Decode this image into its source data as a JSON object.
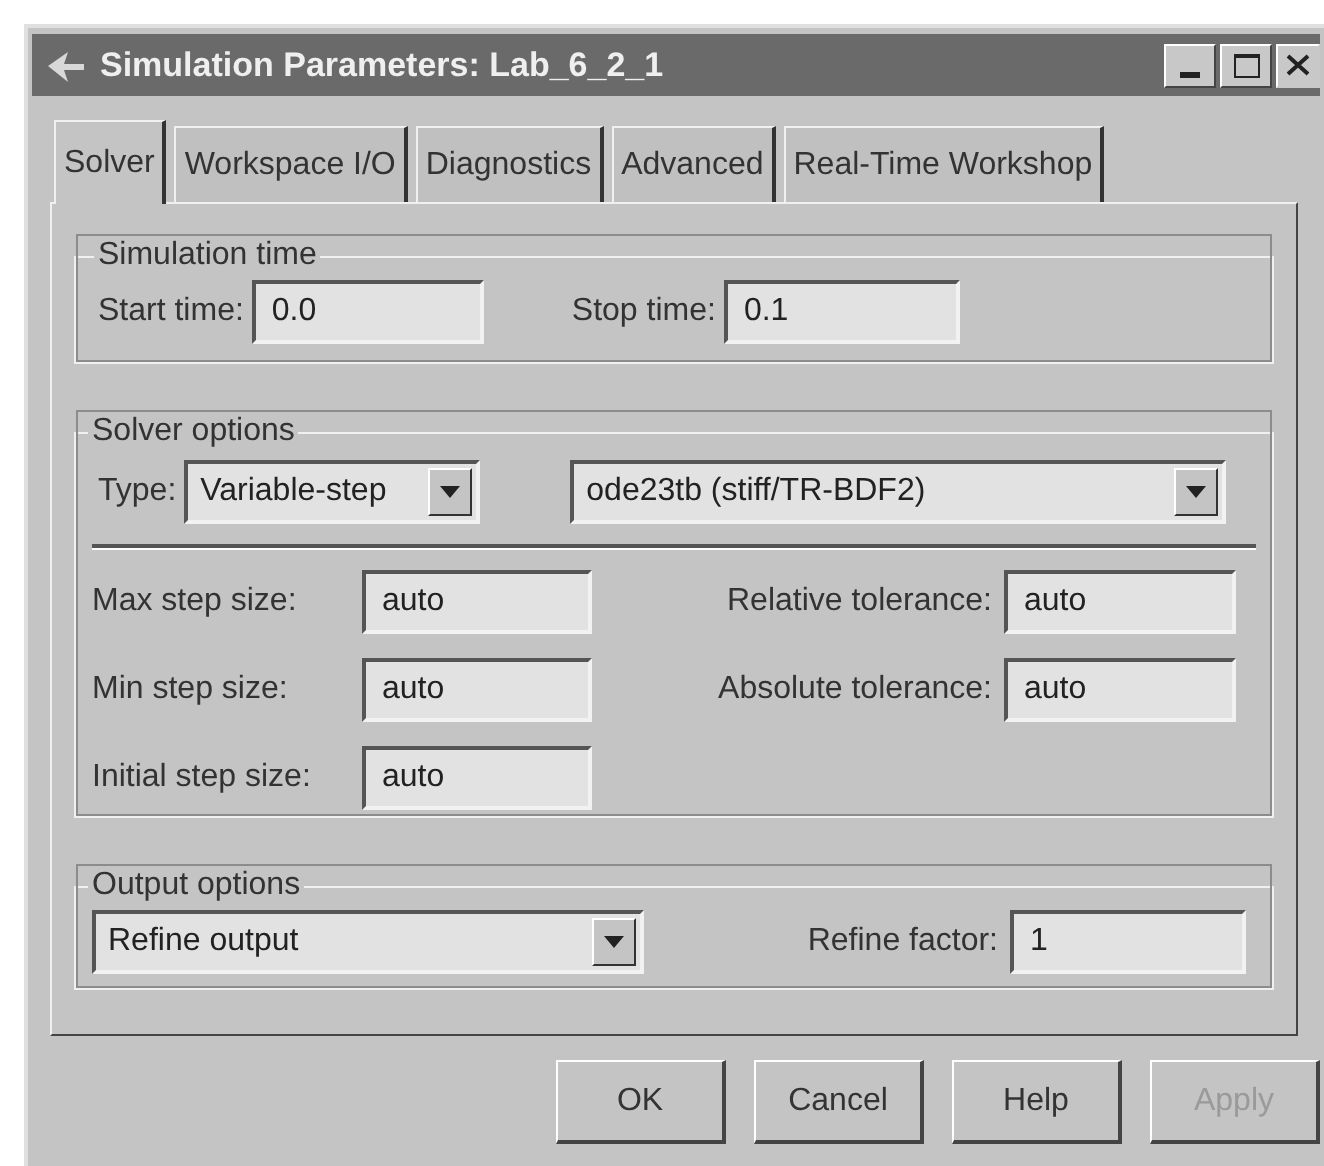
{
  "window": {
    "title": "Simulation Parameters: Lab_6_2_1"
  },
  "tabs": [
    {
      "label": "Solver",
      "selected": true
    },
    {
      "label": "Workspace I/O",
      "selected": false
    },
    {
      "label": "Diagnostics",
      "selected": false
    },
    {
      "label": "Advanced",
      "selected": false
    },
    {
      "label": "Real-Time Workshop",
      "selected": false
    }
  ],
  "simulation_time": {
    "title": "Simulation time",
    "start_time": {
      "label": "Start time:",
      "value": "0.0"
    },
    "stop_time": {
      "label": "Stop time:",
      "value": "0.1"
    }
  },
  "solver_options": {
    "title": "Solver options",
    "type": {
      "label": "Type:",
      "value": "Variable-step"
    },
    "solver": {
      "value": "ode23tb (stiff/TR-BDF2)"
    },
    "left_fields": [
      {
        "label": "Max step size:",
        "value": "auto"
      },
      {
        "label": "Min step size:",
        "value": "auto"
      },
      {
        "label": "Initial step size:",
        "value": "auto"
      }
    ],
    "right_fields": [
      {
        "label": "Relative tolerance:",
        "value": "auto"
      },
      {
        "label": "Absolute tolerance:",
        "value": "auto"
      }
    ]
  },
  "output_options": {
    "title": "Output options",
    "mode": {
      "value": "Refine output"
    },
    "refine_factor": {
      "label": "Refine factor:",
      "value": "1"
    }
  },
  "buttons": [
    {
      "label": "OK",
      "disabled": false
    },
    {
      "label": "Cancel",
      "disabled": false
    },
    {
      "label": "Help",
      "disabled": false
    },
    {
      "label": "Apply",
      "disabled": true
    }
  ]
}
